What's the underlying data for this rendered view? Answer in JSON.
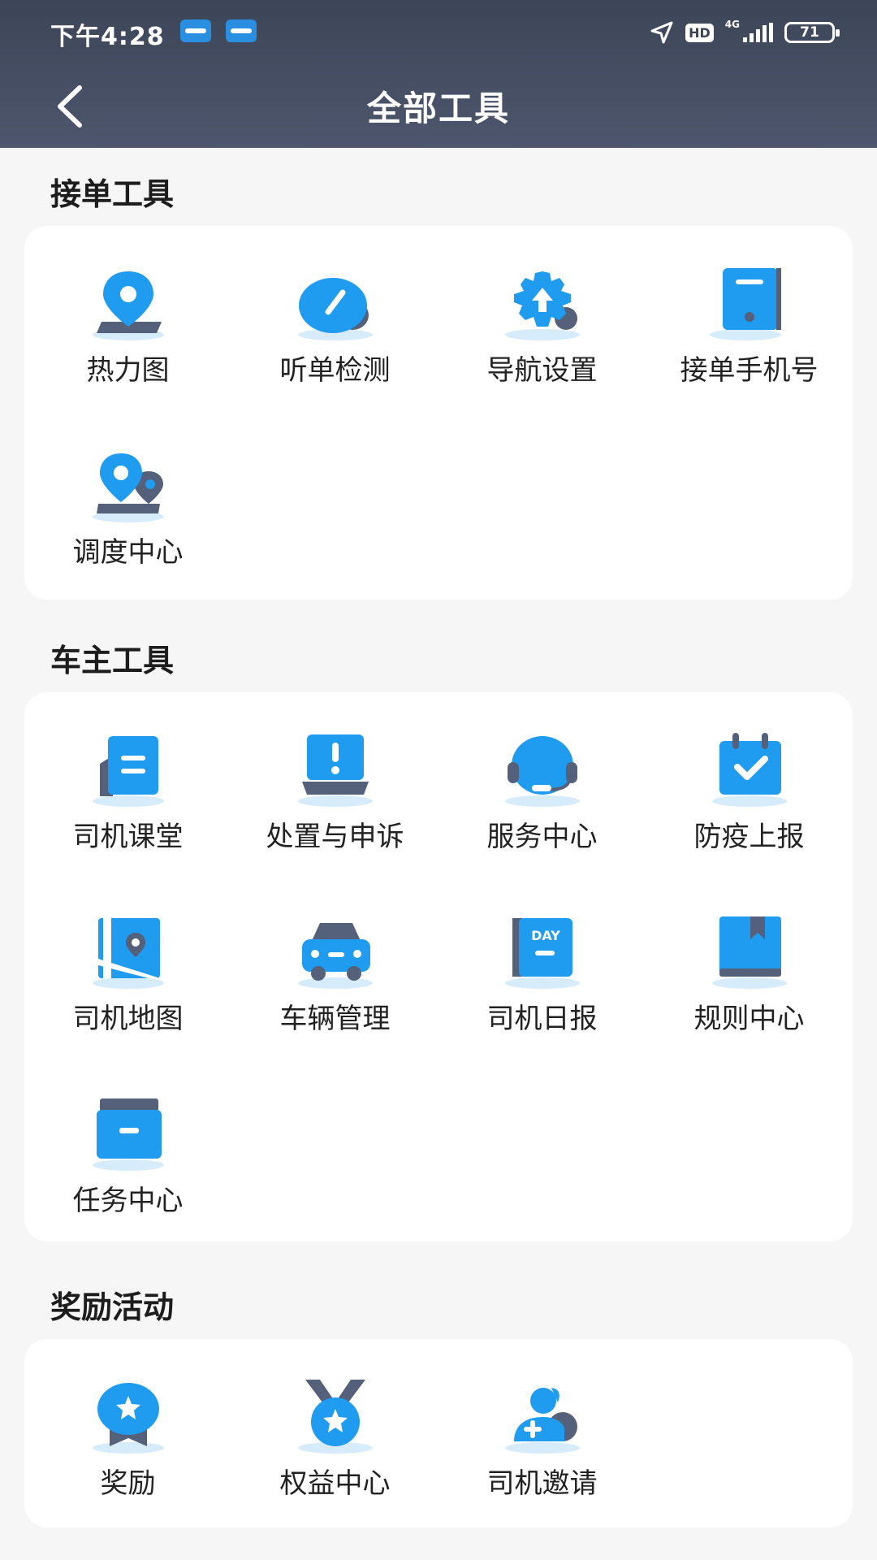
{
  "status_bar": {
    "time": "下午4:28",
    "network": "4G",
    "hd": "HD",
    "battery": "71"
  },
  "header": {
    "title": "全部工具"
  },
  "sections": [
    {
      "title": "接单工具",
      "tools": [
        {
          "label": "热力图",
          "icon": "heatmap-pin-icon"
        },
        {
          "label": "听单检测",
          "icon": "gauge-icon"
        },
        {
          "label": "导航设置",
          "icon": "gear-arrow-icon"
        },
        {
          "label": "接单手机号",
          "icon": "phone-icon"
        },
        {
          "label": "调度中心",
          "icon": "dispatch-pins-icon"
        }
      ]
    },
    {
      "title": "车主工具",
      "tools": [
        {
          "label": "司机课堂",
          "icon": "notebook-icon"
        },
        {
          "label": "处置与申诉",
          "icon": "alert-laptop-icon"
        },
        {
          "label": "服务中心",
          "icon": "headset-icon"
        },
        {
          "label": "防疫上报",
          "icon": "calendar-check-icon"
        },
        {
          "label": "司机地图",
          "icon": "map-icon"
        },
        {
          "label": "车辆管理",
          "icon": "car-icon"
        },
        {
          "label": "司机日报",
          "icon": "day-report-icon",
          "badge": "DAY"
        },
        {
          "label": "规则中心",
          "icon": "rule-book-icon"
        },
        {
          "label": "任务中心",
          "icon": "task-box-icon"
        }
      ]
    },
    {
      "title": "奖励活动",
      "tools": [
        {
          "label": "奖励",
          "icon": "reward-star-icon"
        },
        {
          "label": "权益中心",
          "icon": "medal-icon"
        },
        {
          "label": "司机邀请",
          "icon": "invite-user-icon"
        }
      ]
    }
  ],
  "colors": {
    "header": "#434b5f",
    "icon_blue": "#1f9bf0",
    "icon_dark": "#55607a",
    "background": "#f6f6f6"
  }
}
